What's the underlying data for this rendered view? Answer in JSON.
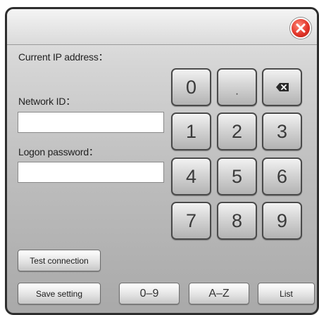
{
  "labels": {
    "current_ip": "Current IP address：",
    "network_id": "Network ID：",
    "logon_password": "Logon password："
  },
  "fields": {
    "network_id_value": "",
    "logon_password_value": ""
  },
  "keypad": {
    "row1": [
      "0",
      "·"
    ],
    "row2": [
      "1",
      "2",
      "3"
    ],
    "row3": [
      "4",
      "5",
      "6"
    ],
    "row4": [
      "7",
      "8",
      "9"
    ],
    "backspace_icon": "backspace-icon"
  },
  "buttons": {
    "test_connection": "Test connection",
    "save_setting": "Save setting",
    "digits_mode": "0–9",
    "letters_mode": "A–Z",
    "list": "List"
  },
  "icons": {
    "close": "close-icon"
  },
  "colors": {
    "close_red": "#e2362a",
    "panel_gray": "#bdbdbd"
  }
}
